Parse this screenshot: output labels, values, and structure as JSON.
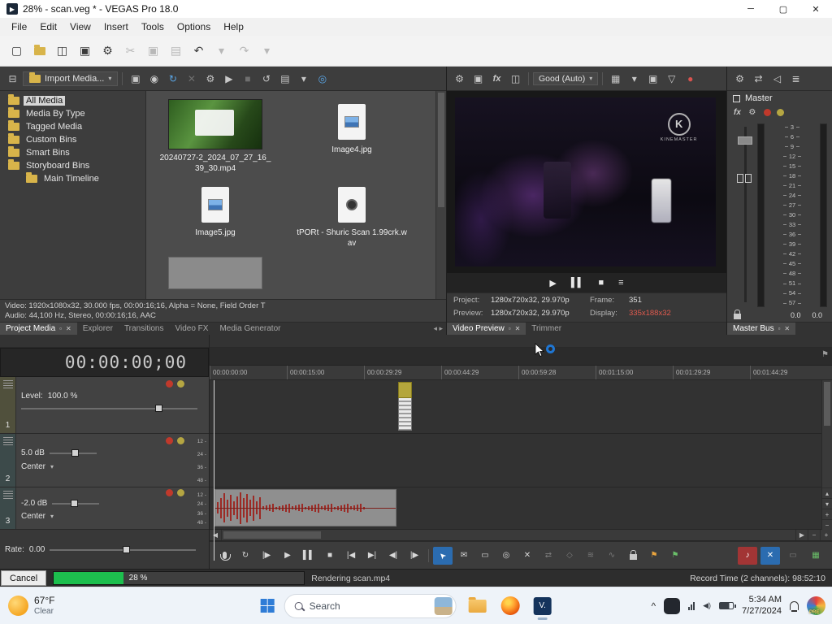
{
  "window": {
    "title": "28% - scan.veg * - VEGAS Pro 18.0",
    "controls": {
      "minimize": "─",
      "maximize": "▢",
      "close": "✕"
    }
  },
  "menu": {
    "items": [
      "File",
      "Edit",
      "View",
      "Insert",
      "Tools",
      "Options",
      "Help"
    ]
  },
  "toolbar": {
    "icons": [
      {
        "name": "new-project-button",
        "glyph": "▢"
      },
      {
        "name": "open-project-button",
        "icon": "folder"
      },
      {
        "name": "save-project-button",
        "glyph": "◫"
      },
      {
        "name": "render-as-button",
        "glyph": "▣"
      },
      {
        "name": "project-properties-button",
        "glyph": "⚙"
      },
      {
        "name": "cut-button",
        "glyph": "✂",
        "disabled": true
      },
      {
        "name": "copy-button",
        "glyph": "▣",
        "disabled": true
      },
      {
        "name": "paste-button",
        "glyph": "▤",
        "disabled": true
      },
      {
        "name": "undo-button",
        "glyph": "↶"
      },
      {
        "name": "undo-dropdown",
        "glyph": "▾",
        "disabled": true
      },
      {
        "name": "redo-button",
        "glyph": "↷",
        "disabled": true
      },
      {
        "name": "redo-dropdown",
        "glyph": "▾",
        "disabled": true
      }
    ]
  },
  "media_panel": {
    "dock_icon": "⊟",
    "import_label": "Import Media...",
    "toolbar_icons": [
      {
        "name": "capture-video-button",
        "glyph": "▣"
      },
      {
        "name": "extract-audio-button",
        "glyph": "◉"
      },
      {
        "name": "get-media-from-web-button",
        "glyph": "↻",
        "color": "#5aa7e8"
      },
      {
        "name": "remove-media-button",
        "glyph": "✕",
        "disabled": true
      },
      {
        "name": "media-properties-button",
        "glyph": "⚙"
      },
      {
        "name": "start-preview-button",
        "glyph": "▶"
      },
      {
        "name": "stop-preview-button",
        "glyph": "■",
        "disabled": true
      },
      {
        "name": "auto-preview-button",
        "glyph": "↺"
      },
      {
        "name": "media-views-button",
        "glyph": "▤"
      },
      {
        "name": "media-views-dropdown",
        "glyph": "▾"
      },
      {
        "name": "search-media-button",
        "glyph": "◎",
        "color": "#5aa7e8"
      }
    ],
    "tree": [
      {
        "label": "All Media",
        "selected": true
      },
      {
        "label": "Media By Type"
      },
      {
        "label": "Tagged Media"
      },
      {
        "label": "Custom Bins"
      },
      {
        "label": "Smart Bins"
      },
      {
        "label": "Storyboard Bins"
      },
      {
        "label": "Main Timeline",
        "child": true
      }
    ],
    "items": [
      {
        "name": "20240727-2_2024_07_27_16_39_30.mp4",
        "type": "video"
      },
      {
        "name": "Image4.jpg",
        "type": "image"
      },
      {
        "name": "Image5.jpg",
        "type": "image"
      },
      {
        "name": "tPORt - Shuric Scan 1.99crk.wav",
        "type": "audio"
      },
      {
        "name": "",
        "type": "loading"
      }
    ],
    "info_line1": "Video: 1920x1080x32, 30.000 fps, 00:00:16;16, Alpha = None, Field Order T",
    "info_line2": "Audio: 44,100 Hz, Stereo, 00:00:16;16, AAC",
    "tabs": [
      {
        "label": "Project Media",
        "active": true
      },
      {
        "label": "Explorer"
      },
      {
        "label": "Transitions"
      },
      {
        "label": "Video FX"
      },
      {
        "label": "Media Generator"
      }
    ]
  },
  "preview_panel": {
    "toolbar_left": [
      {
        "name": "preview-settings-button",
        "glyph": "⚙"
      },
      {
        "name": "external-monitor-button",
        "glyph": "▣"
      },
      {
        "name": "video-output-fx-button",
        "glyph": "fx",
        "em": true
      },
      {
        "name": "split-screen-view-button",
        "glyph": "◫"
      }
    ],
    "quality": "Good (Auto)",
    "toolbar_right": [
      {
        "name": "grid-overlay-button",
        "glyph": "▦"
      },
      {
        "name": "grid-dropdown",
        "glyph": "▾"
      },
      {
        "name": "copy-snapshot-button",
        "glyph": "▣"
      },
      {
        "name": "save-snapshot-button",
        "glyph": "▽"
      },
      {
        "name": "record-button",
        "glyph": "●",
        "color": "#d9534f"
      }
    ],
    "watermark_letter": "K",
    "watermark_text": "KINEMASTER",
    "transport": [
      {
        "name": "preview-play-button",
        "glyph": "▶"
      },
      {
        "name": "preview-pause-button",
        "glyph": "▌▌"
      },
      {
        "name": "preview-stop-button",
        "glyph": "■"
      },
      {
        "name": "preview-menu-button",
        "glyph": "≡"
      }
    ],
    "info": {
      "project_label": "Project:",
      "project_value": "1280x720x32, 29.970p",
      "frame_label": "Frame:",
      "frame_value": "351",
      "preview_label": "Preview:",
      "preview_value": "1280x720x32, 29.970p",
      "display_label": "Display:",
      "display_value": "335x188x32"
    },
    "tabs": [
      {
        "label": "Video Preview",
        "active": true
      },
      {
        "label": "Trimmer"
      }
    ]
  },
  "master_bus": {
    "toolbar": [
      {
        "name": "master-properties-button",
        "glyph": "⚙"
      },
      {
        "name": "downmix-output-button",
        "glyph": "⇄"
      },
      {
        "name": "dim-output-button",
        "glyph": "◁"
      },
      {
        "name": "meter-options-button",
        "glyph": "≣"
      }
    ],
    "title": "Master",
    "fx_label": "fx",
    "scale": [
      "3",
      "6",
      "9",
      "12",
      "15",
      "18",
      "21",
      "24",
      "27",
      "30",
      "33",
      "36",
      "39",
      "42",
      "45",
      "48",
      "51",
      "54",
      "57"
    ],
    "left_db": "0.0",
    "right_db": "0.0",
    "tab_label": "Master Bus"
  },
  "timeline": {
    "timecode": "00:00:00;00",
    "ruler": [
      "00:00:00:00",
      "00:00:15:00",
      "00:00:29:29",
      "00:00:44:29",
      "00:00:59:28",
      "00:01:15:00",
      "00:01:29:29",
      "00:01:44:29"
    ],
    "tracks": [
      {
        "number": "1",
        "level_label": "Level:",
        "level_value": "100.0 %"
      },
      {
        "number": "2",
        "volume": "5.0 dB",
        "pan": "Center"
      },
      {
        "number": "3",
        "volume": "-2.0 dB",
        "pan": "Center"
      }
    ],
    "meter_marks": [
      "12",
      "24",
      "36",
      "48"
    ],
    "rate_label": "Rate:",
    "rate_value": "0.00"
  },
  "transport": {
    "left": [
      {
        "name": "record-button",
        "icon": "mic"
      },
      {
        "name": "loop-playback-button",
        "glyph": "↻"
      },
      {
        "name": "play-from-start-button",
        "glyph": "|▶"
      },
      {
        "name": "play-button",
        "glyph": "▶"
      },
      {
        "name": "pause-button",
        "glyph": "▌▌"
      },
      {
        "name": "stop-button",
        "glyph": "■"
      },
      {
        "name": "go-to-start-button",
        "glyph": "|◀"
      },
      {
        "name": "go-to-end-button",
        "glyph": "▶|"
      },
      {
        "name": "previous-frame-button",
        "glyph": "◀|"
      },
      {
        "name": "next-frame-button",
        "glyph": "|▶"
      }
    ],
    "tools": [
      {
        "name": "normal-edit-tool",
        "glyph": "➤",
        "active": true,
        "rot": true
      },
      {
        "name": "envelope-edit-tool",
        "glyph": "✉"
      },
      {
        "name": "selection-edit-tool",
        "glyph": "▭"
      },
      {
        "name": "zoom-edit-tool",
        "glyph": "◎"
      },
      {
        "name": "erase-tool",
        "glyph": "✕"
      },
      {
        "name": "trim-tool",
        "glyph": "⇄",
        "disabled": true
      },
      {
        "name": "split-tool",
        "glyph": "◇",
        "disabled": true
      },
      {
        "name": "snapping-tool",
        "glyph": "≋",
        "disabled": true
      },
      {
        "name": "auto-ripple-tool",
        "glyph": "∿",
        "disabled": true
      },
      {
        "name": "lock-envelopes-button",
        "icon": "lock"
      },
      {
        "name": "insert-marker-button",
        "glyph": "⚑",
        "color": "#e8a33d"
      },
      {
        "name": "insert-region-button",
        "glyph": "⚑",
        "color": "#6abf69"
      }
    ],
    "right": [
      {
        "name": "mute-all-audio-button",
        "glyph": "♪",
        "bg": "#a23535"
      },
      {
        "name": "mute-all-video-button",
        "glyph": "✕",
        "bg": "#2b6cb0"
      },
      {
        "name": "bypass-fx-button",
        "glyph": "▭",
        "disabled": true
      },
      {
        "name": "mixer-grid-button",
        "glyph": "▦",
        "color": "#6abf69"
      }
    ]
  },
  "status_bar": {
    "cancel_label": "Cancel",
    "progress_percent": 28,
    "progress_label": "28 %",
    "status_text": "Rendering scan.mp4",
    "record_time": "Record Time (2 channels): 98:52:10"
  },
  "taskbar": {
    "temp": "67°F",
    "condition": "Clear",
    "search_label": "Search",
    "vegas_icon_text": "V.",
    "time": "5:34 AM",
    "date": "7/27/2024",
    "badge": "PRE"
  }
}
